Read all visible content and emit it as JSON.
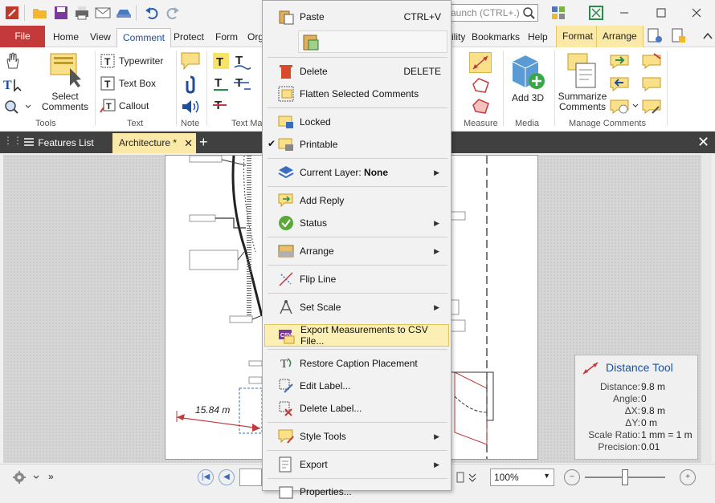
{
  "search": {
    "placeholder": "aunch (CTRL+.)"
  },
  "tabs": {
    "file": "File",
    "home": "Home",
    "view": "View",
    "comment": "Comment",
    "protect": "Protect",
    "form": "Form",
    "org": "Org",
    "ility": "ility",
    "bookmarks": "Bookmarks",
    "help": "Help",
    "format": "Format",
    "arrange": "Arrange"
  },
  "ribbon": {
    "select_comments": "Select Comments",
    "tools_group": "Tools",
    "typewriter": "Typewriter",
    "text_box": "Text Box",
    "callout": "Callout",
    "text_group": "Text",
    "note_group": "Note",
    "text_markup_group": "Text Ma",
    "measure_group": "Measure",
    "add_3d": "Add 3D",
    "media_group": "Media",
    "summarize_comments": "Summarize Comments",
    "manage_comments_group": "Manage Comments"
  },
  "doctabs": {
    "features_list": "Features List",
    "architecture": "Architecture *"
  },
  "context_menu": {
    "paste": "Paste",
    "paste_shortcut": "CTRL+V",
    "delete": "Delete",
    "delete_shortcut": "DELETE",
    "flatten": "Flatten Selected Comments",
    "locked": "Locked",
    "printable": "Printable",
    "current_layer_prefix": "Current Layer: ",
    "current_layer_value": "None",
    "add_reply": "Add Reply",
    "status": "Status",
    "arrange": "Arrange",
    "flip_line": "Flip Line",
    "set_scale": "Set Scale",
    "export_csv": "Export Measurements to CSV File...",
    "restore_caption": "Restore Caption Placement",
    "edit_label": "Edit Label...",
    "delete_label": "Delete Label...",
    "style_tools": "Style Tools",
    "export": "Export",
    "properties": "Properties..."
  },
  "drawing": {
    "measurement_label": "15.84 m"
  },
  "distance_tool": {
    "title": "Distance Tool",
    "rows": [
      {
        "k": "Distance:",
        "v": "9.8 m"
      },
      {
        "k": "Angle:",
        "v": "0"
      },
      {
        "k": "ΔX:",
        "v": "9.8 m"
      },
      {
        "k": "ΔY:",
        "v": "0 m"
      },
      {
        "k": "Scale Ratio:",
        "v": "1 mm = 1 m"
      },
      {
        "k": "Precision:",
        "v": "0.01"
      }
    ]
  },
  "statusbar": {
    "zoom": "100%"
  }
}
